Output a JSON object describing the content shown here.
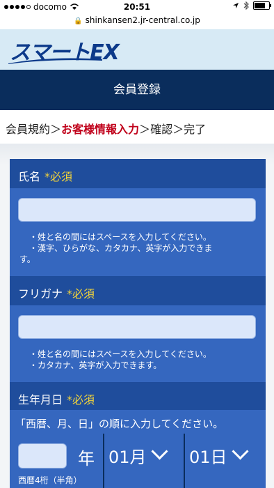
{
  "status_bar": {
    "carrier": "docomo",
    "time": "20:51"
  },
  "browser": {
    "url": "shinkansen2.jr-central.co.jp"
  },
  "logo": {
    "text_a": "スマート",
    "text_b": "EX"
  },
  "header": {
    "title": "会員登録"
  },
  "breadcrumb": {
    "step1": "会員規約",
    "sep1": "＞",
    "step2": "お客様情報入力",
    "sep2": "＞",
    "step3": "確認",
    "sep3": "＞",
    "step4": "完了"
  },
  "form": {
    "name": {
      "label": "氏名",
      "required": "*必須",
      "notes": [
        "・姓と名の間にはスペースを入力してください。",
        "・漢字、ひらがな、カタカナ、英字が入力できま",
        "す。"
      ]
    },
    "furigana": {
      "label": "フリガナ",
      "required": "*必須",
      "notes": [
        "・姓と名の間にはスペースを入力してください。",
        "・カタカナ、英字が入力できます。"
      ]
    },
    "birthdate": {
      "label": "生年月日",
      "required": "*必須",
      "instruction": "「西暦、月、日」の順に入力してください。",
      "year_unit": "年",
      "month_value": "01月",
      "day_value": "01日",
      "year_help": "西暦4桁（半角）"
    }
  },
  "colors": {
    "header_navy": "#0a2d5c",
    "panel_blue": "#3567bf",
    "section_blue": "#1f4d9c",
    "required_yellow": "#f2d33a",
    "breadcrumb_current": "#c0001a"
  }
}
